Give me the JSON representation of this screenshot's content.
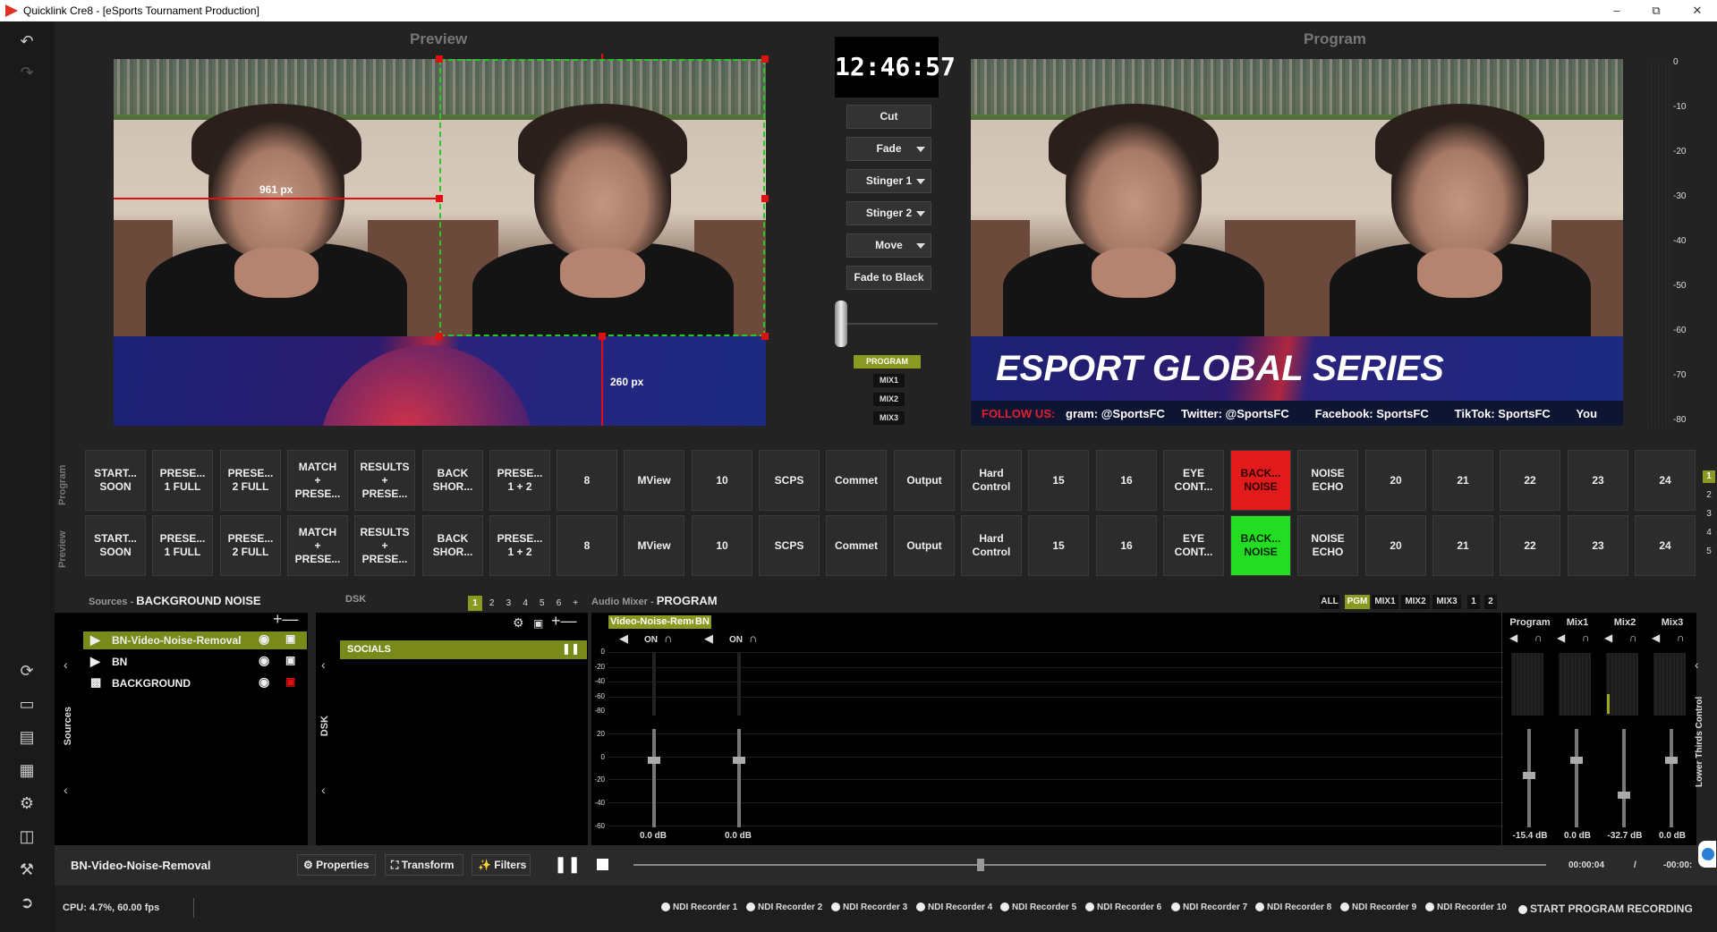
{
  "window": {
    "title": "Quicklink Cre8 - [eSports Tournament Production]"
  },
  "preview": {
    "label": "Preview",
    "measure_h": "961 px",
    "measure_v": "260 px"
  },
  "program": {
    "label": "Program",
    "banner_title": "ESPORT GLOBAL SERIES",
    "follow_label": "FOLLOW US:",
    "ticker": "gram: @SportsFC     Twitter: @SportsFC        Facebook: SportsFC        TikTok: SportsFC        You"
  },
  "clock": {
    "time": "12:46:57"
  },
  "transitions": {
    "cut": "Cut",
    "fade": "Fade",
    "stinger1": "Stinger 1",
    "stinger2": "Stinger 2",
    "move": "Move",
    "fade_black": "Fade to Black"
  },
  "mix_targets": [
    "PROGRAM",
    "MIX1",
    "MIX2",
    "MIX3"
  ],
  "switcher": {
    "program_label": "Program",
    "preview_label": "Preview",
    "tiles": [
      "START...\nSOON",
      "PRESE...\n1 FULL",
      "PRESE...\n2 FULL",
      "MATCH\n+\nPRESE...",
      "RESULTS\n+\nPRESE...",
      "BACK\nSHOR...",
      "PRESE...\n1 + 2",
      "8",
      "MView",
      "10",
      "SCPS",
      "Commet",
      "Output",
      "Hard\nControl",
      "15",
      "16",
      "EYE\nCONT...",
      "BACK...\nNOISE",
      "NOISE\nECHO",
      "20",
      "21",
      "22",
      "23",
      "24"
    ],
    "pages": [
      "1",
      "2",
      "3",
      "4",
      "5"
    ],
    "program_active_color": "#e11b1b",
    "preview_active_color": "#22dd22"
  },
  "sources": {
    "header_prefix": "Sources",
    "header_name": "BACKGROUND NOISE",
    "side_label": "Sources",
    "items": [
      "BN-Video-Noise-Removal",
      "BN",
      "BACKGROUND"
    ]
  },
  "dsk": {
    "label": "DSK",
    "pages": [
      "1",
      "2",
      "3",
      "4",
      "5",
      "6",
      "+"
    ],
    "side_label": "DSK",
    "item": "SOCIALS"
  },
  "audio": {
    "header_prefix": "Audio Mixer",
    "header_name": "PROGRAM",
    "tabs": [
      "ALL",
      "PGM",
      "MIX1",
      "MIX2",
      "MIX3",
      "1",
      "2"
    ],
    "channels": [
      {
        "name": "Video-Noise-Remo",
        "on": "ON",
        "db": "0.0 dB",
        "level": 0.72
      },
      {
        "name": "BN",
        "on": "ON",
        "db": "0.0 dB",
        "level": 0.72
      }
    ],
    "outputs": [
      {
        "name": "Program",
        "db": "-15.4 dB",
        "level": 0.56
      },
      {
        "name": "Mix1",
        "db": "0.0 dB",
        "level": 0.72
      },
      {
        "name": "Mix2",
        "db": "-32.7 dB",
        "level": 0.36
      },
      {
        "name": "Mix3",
        "db": "0.0 dB",
        "level": 0.72
      }
    ],
    "scale_top": [
      "0",
      "-20",
      "-40",
      "-60",
      "-80"
    ],
    "scale_bottom": [
      "20",
      "0",
      "-20",
      "-40",
      "-60"
    ],
    "lower_thirds": "Lower Thirds Control"
  },
  "meter": {
    "marks": [
      "0",
      "-10",
      "-20",
      "-30",
      "-40",
      "-50",
      "-60",
      "-70",
      "-80"
    ]
  },
  "bottombar": {
    "selected": "BN-Video-Noise-Removal",
    "properties": "Properties",
    "transform": "Transform",
    "filters": "Filters",
    "time": "00:00:04",
    "slash": "/",
    "total": "-00:00:"
  },
  "status": {
    "cpu": "CPU: 4.7%, 60.00 fps",
    "recorders": [
      "NDI Recorder 1",
      "NDI Recorder 2",
      "NDI Recorder 3",
      "NDI Recorder 4",
      "NDI Recorder 5",
      "NDI Recorder 6",
      "NDI Recorder 7",
      "NDI Recorder 8",
      "NDI Recorder 9",
      "NDI Recorder 10"
    ],
    "start_recording": "START PROGRAM RECORDING"
  }
}
